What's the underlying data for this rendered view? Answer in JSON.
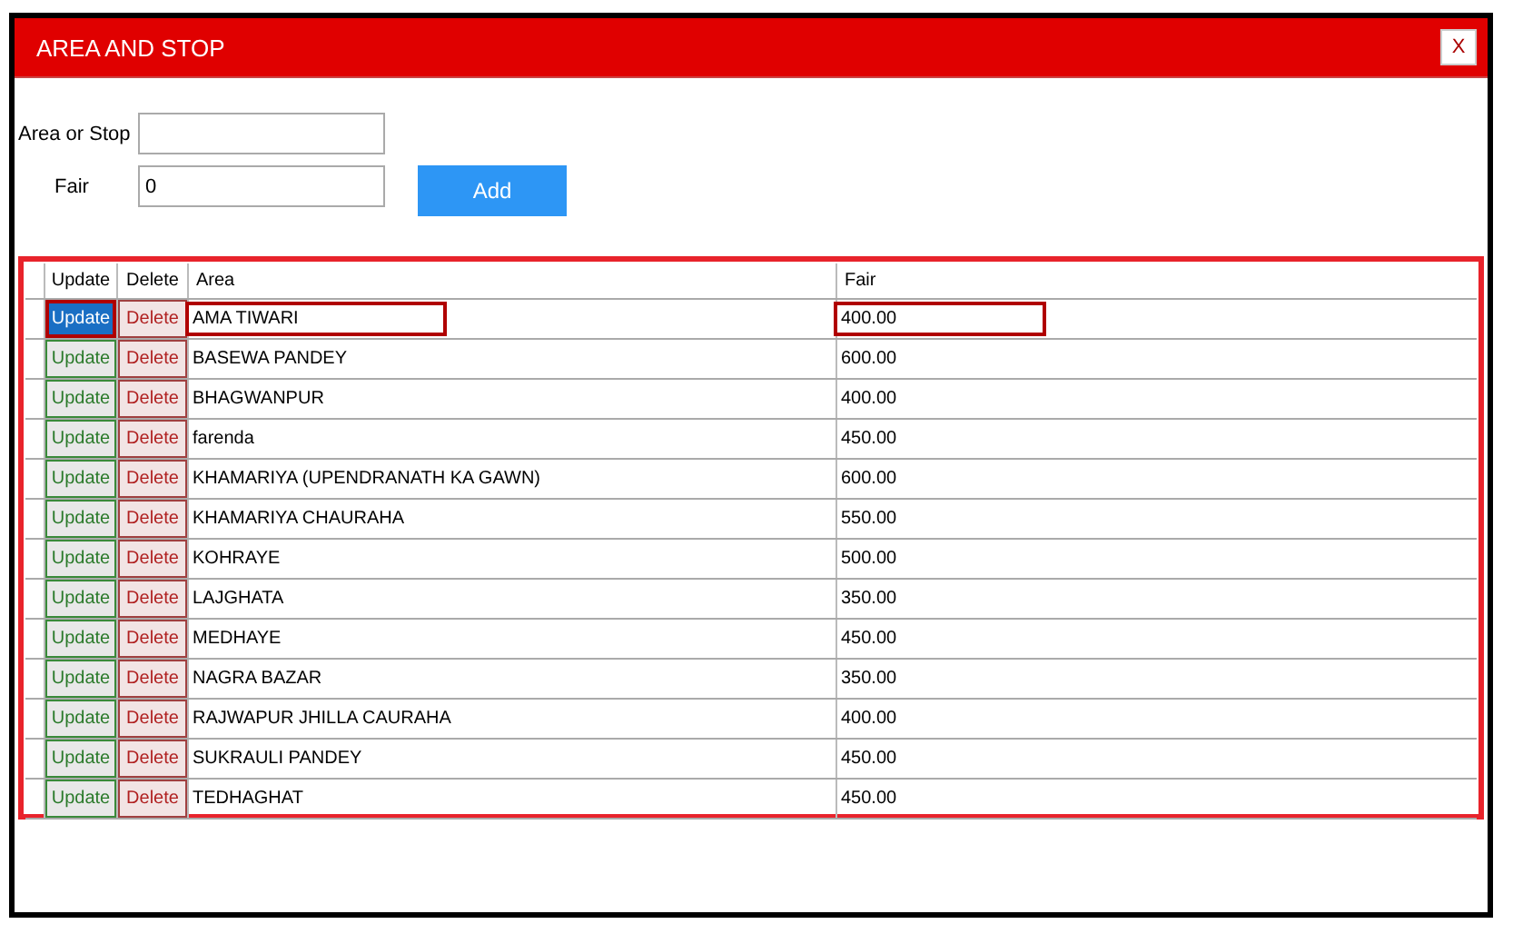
{
  "window": {
    "title": "AREA AND STOP",
    "close": "X"
  },
  "form": {
    "fields": [
      {
        "label": "Area or Stop"
      },
      {
        "label": "Fair",
        "value": "0"
      }
    ],
    "button": "Add"
  },
  "table": {
    "columns": [
      "Update",
      "Delete",
      "Area",
      "Fair"
    ],
    "rows": [
      {
        "update": "Update",
        "delete": "Delete",
        "area": "AMA TIWARI",
        "fair": "400.00",
        "selected": true
      },
      {
        "update": "Update",
        "delete": "Delete",
        "area": "BASEWA PANDEY",
        "fair": "600.00",
        "selected": false
      },
      {
        "update": "Update",
        "delete": "Delete",
        "area": "BHAGWANPUR",
        "fair": "400.00",
        "selected": false
      },
      {
        "update": "Update",
        "delete": "Delete",
        "area": "farenda",
        "fair": "450.00",
        "selected": false
      },
      {
        "update": "Update",
        "delete": "Delete",
        "area": "KHAMARIYA (UPENDRANATH KA GAWN)",
        "fair": "600.00",
        "selected": false
      },
      {
        "update": "Update",
        "delete": "Delete",
        "area": "KHAMARIYA CHAURAHA",
        "fair": "550.00",
        "selected": false
      },
      {
        "update": "Update",
        "delete": "Delete",
        "area": "KOHRAYE",
        "fair": "500.00",
        "selected": false
      },
      {
        "update": "Update",
        "delete": "Delete",
        "area": "LAJGHATA",
        "fair": "350.00",
        "selected": false
      },
      {
        "update": "Update",
        "delete": "Delete",
        "area": "MEDHAYE",
        "fair": "450.00",
        "selected": false
      },
      {
        "update": "Update",
        "delete": "Delete",
        "area": "NAGRA BAZAR",
        "fair": "350.00",
        "selected": false
      },
      {
        "update": "Update",
        "delete": "Delete",
        "area": "RAJWAPUR JHILLA CAURAHA",
        "fair": "400.00",
        "selected": false
      },
      {
        "update": "Update",
        "delete": "Delete",
        "area": "SUKRAULI PANDEY",
        "fair": "450.00",
        "selected": false
      },
      {
        "update": "Update",
        "delete": "Delete",
        "area": "TEDHAGHAT",
        "fair": "450.00",
        "selected": false
      }
    ]
  }
}
